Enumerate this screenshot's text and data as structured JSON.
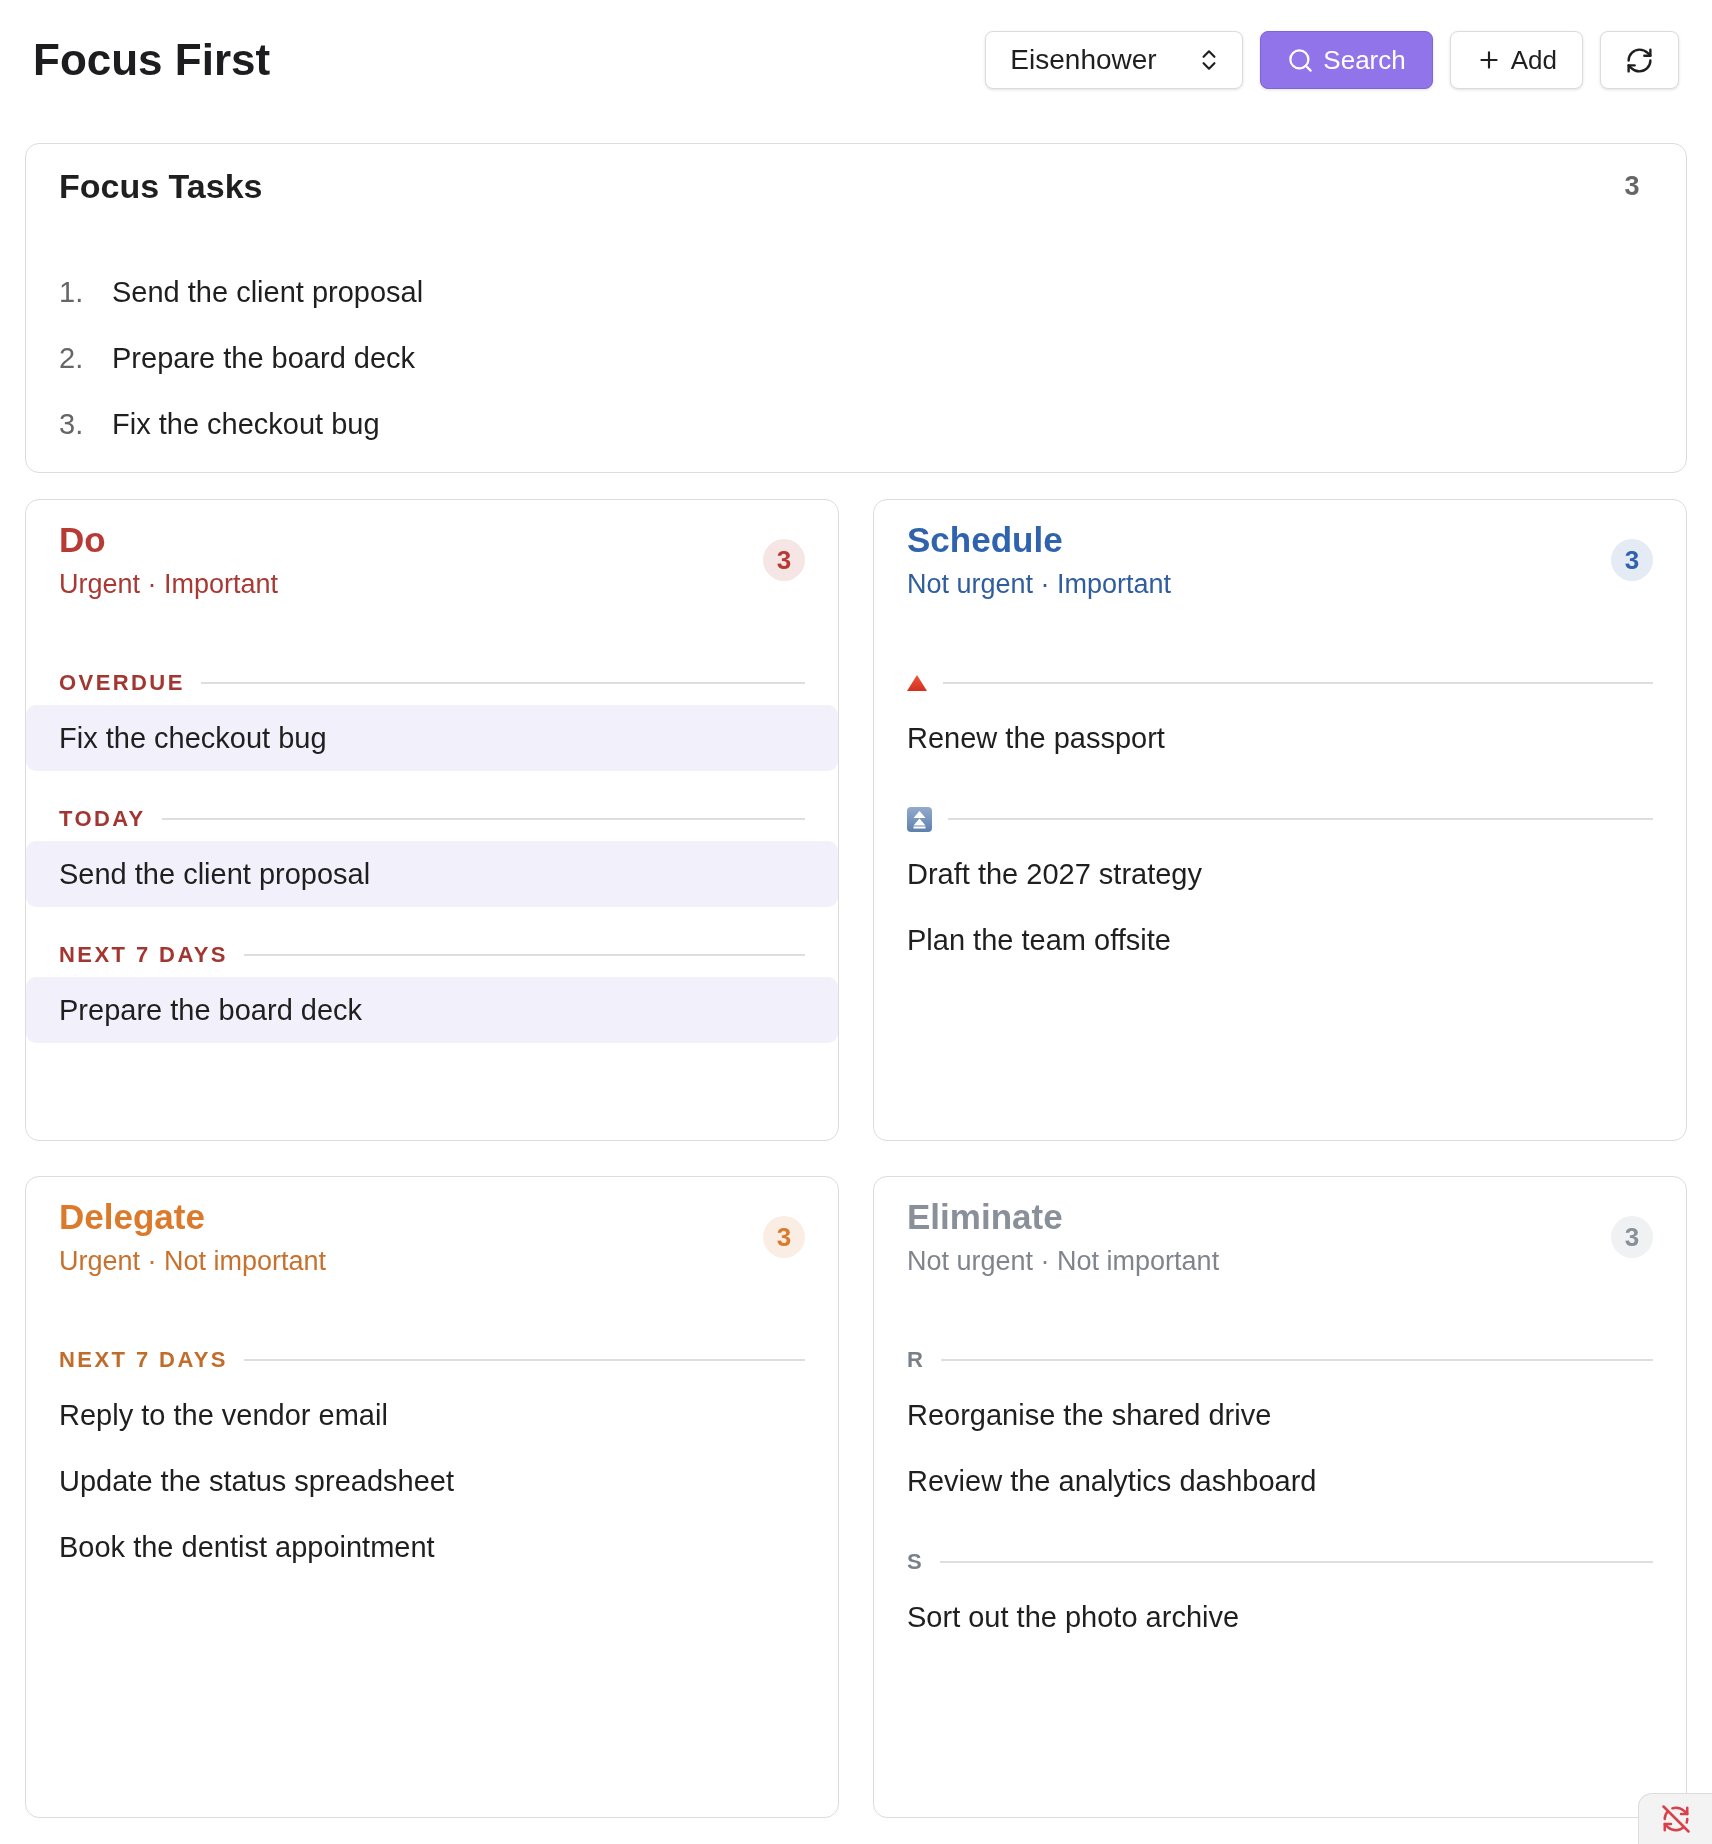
{
  "header": {
    "title": "Focus First",
    "toolbar": [
      {
        "kind": "select",
        "label": "Eisenhower"
      },
      {
        "kind": "search",
        "label": "Search",
        "active": true
      },
      {
        "kind": "add",
        "label": "Add",
        "active": false
      },
      {
        "kind": "refresh",
        "active": false
      }
    ]
  },
  "focus_tasks": {
    "title": "Focus Tasks",
    "count": "3",
    "items": [
      {
        "number": "1.",
        "text": "Send the client proposal"
      },
      {
        "number": "2.",
        "text": "Prepare the board deck"
      },
      {
        "number": "3.",
        "text": "Fix the checkout bug"
      }
    ]
  },
  "quadrants": [
    {
      "title": "Do",
      "subtitle": "Urgent · Important",
      "count": "3",
      "color": "#b83a34",
      "sections": [
        {
          "kind": "label",
          "label": "OVERDUE",
          "tasks": [
            {
              "text": "Fix the checkout bug",
              "in_focus": true
            }
          ]
        },
        {
          "kind": "label",
          "label": "TODAY",
          "tasks": [
            {
              "text": "Send the client proposal",
              "in_focus": true
            }
          ]
        },
        {
          "kind": "label",
          "label": "NEXT 7 DAYS",
          "tasks": [
            {
              "text": "Prepare the board deck",
              "in_focus": true
            }
          ]
        }
      ]
    },
    {
      "title": "Schedule",
      "subtitle": "Not urgent · Important",
      "count": "3",
      "color": "#2f63ad",
      "sections": [
        {
          "kind": "triangle",
          "tasks": [
            {
              "text": "Renew the passport",
              "in_focus": false
            }
          ]
        },
        {
          "kind": "arrows",
          "tasks": [
            {
              "text": "Draft the 2027 strategy",
              "in_focus": false
            },
            {
              "text": "Plan the team offsite",
              "in_focus": false
            }
          ]
        }
      ]
    },
    {
      "title": "Delegate",
      "subtitle": "Urgent · Not important",
      "count": "3",
      "color": "#dc7a2c",
      "sections": [
        {
          "kind": "label",
          "label": "NEXT 7 DAYS",
          "tasks": [
            {
              "text": "Reply to the vendor email",
              "in_focus": false
            },
            {
              "text": "Update the status spreadsheet",
              "in_focus": false
            },
            {
              "text": "Book the dentist appointment",
              "in_focus": false
            }
          ]
        }
      ]
    },
    {
      "title": "Eliminate",
      "subtitle": "Not urgent · Not important",
      "count": "3",
      "color": "#8a9099",
      "sections": [
        {
          "kind": "label",
          "label": "R",
          "tasks": [
            {
              "text": "Reorganise the shared drive",
              "in_focus": false
            },
            {
              "text": "Review the analytics dashboard",
              "in_focus": false
            }
          ]
        },
        {
          "kind": "label",
          "label": "S",
          "tasks": [
            {
              "text": "Sort out the photo archive",
              "in_focus": false
            }
          ]
        }
      ]
    }
  ],
  "sync_indicator": {
    "synced": false
  }
}
